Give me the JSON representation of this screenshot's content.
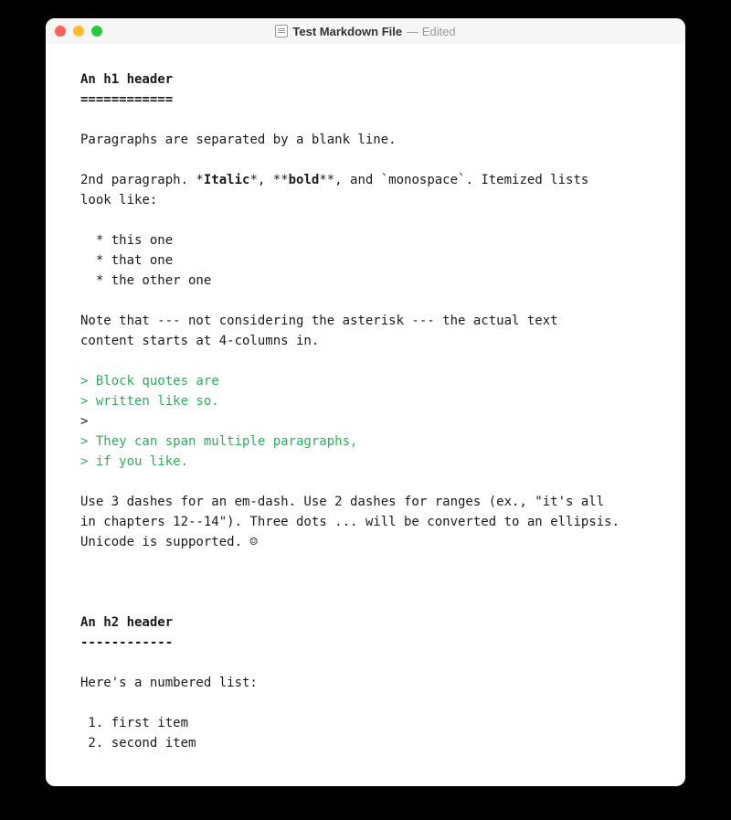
{
  "titlebar": {
    "title": "Test Markdown File",
    "edited_suffix": " — Edited"
  },
  "document": {
    "h1": "An h1 header",
    "h1_underline": "============",
    "p1": "Paragraphs are separated by a blank line.",
    "p2a": "2nd paragraph. *",
    "p2b": "Italic",
    "p2c": "*, **",
    "p2d": "bold",
    "p2e": "**, and `monospace`. Itemized lists",
    "p2f": "look like:",
    "li1": "  * this one",
    "li2": "  * that one",
    "li3": "  * the other one",
    "p3a": "Note that --- not considering the asterisk --- the actual text",
    "p3b": "content starts at 4-columns in.",
    "bq1": "> Block quotes are",
    "bq2": "> written like so.",
    "bq3": ">",
    "bq4": "> They can span multiple paragraphs,",
    "bq5": "> if you like.",
    "p4a": "Use 3 dashes for an em-dash. Use 2 dashes for ranges (ex., \"it's all",
    "p4b": "in chapters 12--14\"). Three dots ... will be converted to an ellipsis.",
    "p4c": "Unicode is supported. ☺",
    "h2": "An h2 header",
    "h2_underline": "------------",
    "p5": "Here's a numbered list:",
    "ol1": " 1. first item",
    "ol2": " 2. second item"
  }
}
